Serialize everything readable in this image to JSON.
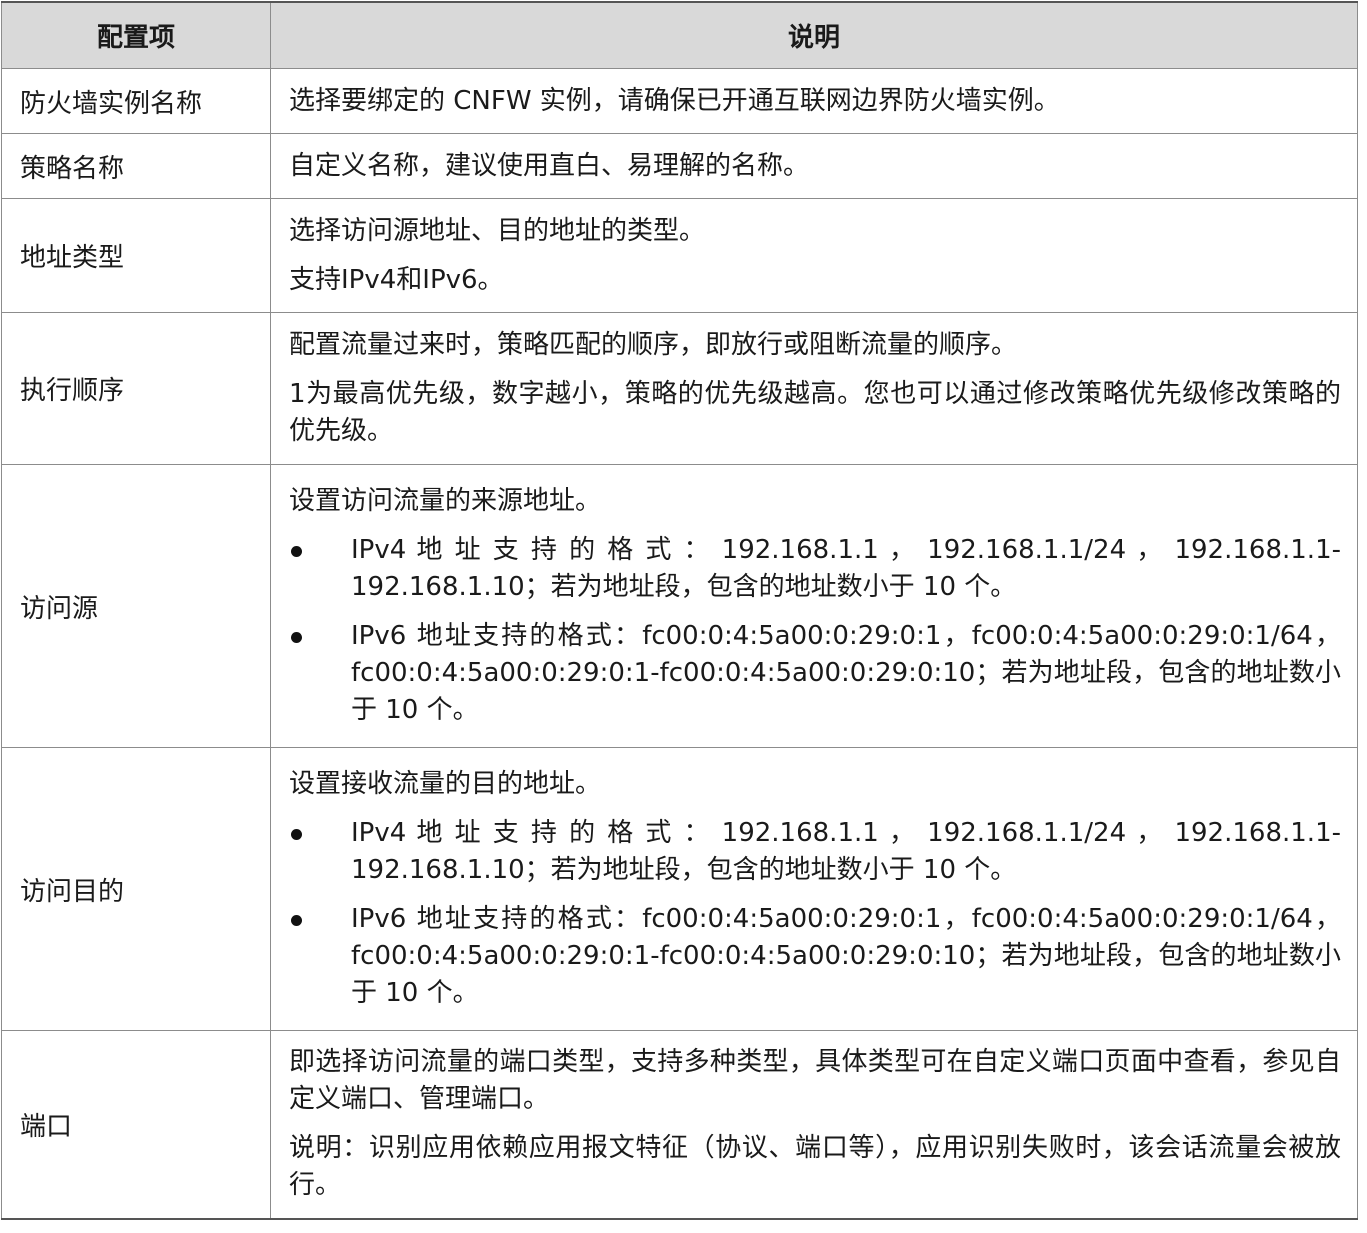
{
  "header": {
    "col1": "配置项",
    "col2": "说明"
  },
  "rows": [
    {
      "name": "防火墙实例名称",
      "p": [
        "选择要绑定的 CNFW 实例，请确保已开通互联网边界防火墙实例。"
      ]
    },
    {
      "name": "策略名称",
      "p": [
        "自定义名称，建议使用直白、易理解的名称。"
      ]
    },
    {
      "name": "地址类型",
      "p": [
        "选择访问源地址、目的地址的类型。",
        "支持IPv4和IPv6。"
      ]
    },
    {
      "name": "执行顺序",
      "p": [
        "配置流量过来时，策略匹配的顺序，即放行或阻断流量的顺序。",
        "1为最高优先级，数字越小，策略的优先级越高。您也可以通过修改策略优先级修改策略的优先级。"
      ]
    },
    {
      "name": "访问源",
      "p": [
        "设置访问流量的来源地址。"
      ],
      "bullets": [
        "IPv4 地 址 支 持 的 格 式 ： 192.168.1.1 ， 192.168.1.1/24 ， 192.168.1.1-192.168.1.10；若为地址段，包含的地址数小于 10 个。",
        "IPv6 地址支持的格式：fc00:0:4:5a00:0:29:0:1，fc00:0:4:5a00:0:29:0:1/64，fc00:0:4:5a00:0:29:0:1-fc00:0:4:5a00:0:29:0:10；若为地址段，包含的地址数小于 10 个。"
      ]
    },
    {
      "name": "访问目的",
      "p": [
        "设置接收流量的目的地址。"
      ],
      "bullets": [
        "IPv4 地 址 支 持 的 格 式 ： 192.168.1.1 ， 192.168.1.1/24 ， 192.168.1.1-192.168.1.10；若为地址段，包含的地址数小于 10 个。",
        "IPv6 地址支持的格式：fc00:0:4:5a00:0:29:0:1，fc00:0:4:5a00:0:29:0:1/64，fc00:0:4:5a00:0:29:0:1-fc00:0:4:5a00:0:29:0:10；若为地址段，包含的地址数小于 10 个。"
      ]
    },
    {
      "name": "端口",
      "p": [
        "即选择访问流量的端口类型，支持多种类型，具体类型可在自定义端口页面中查看，参见自定义端口、管理端口。",
        "说明：识别应用依赖应用报文特征（协议、端口等），应用识别失败时，该会话流量会被放行。"
      ]
    }
  ]
}
